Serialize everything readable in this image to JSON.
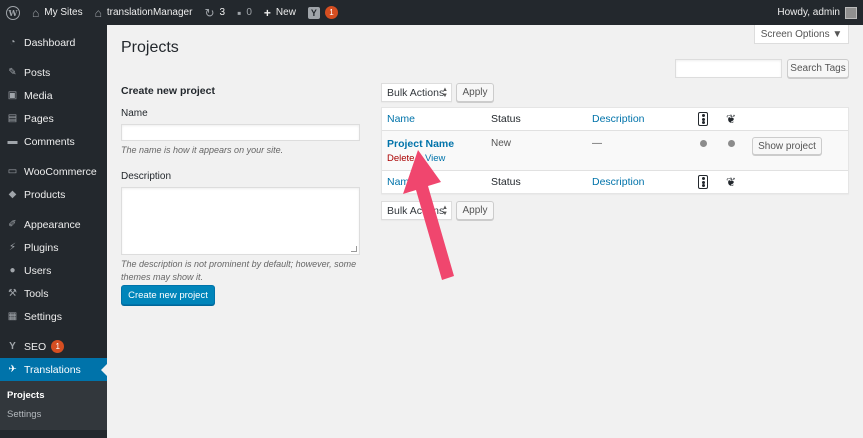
{
  "adminbar": {
    "my_sites": "My Sites",
    "site_name": "translationManager",
    "updates_count": "3",
    "comments_count": "0",
    "new_label": "New",
    "yoast_badge": "1",
    "howdy": "Howdy, admin"
  },
  "sidebar": {
    "items": [
      {
        "label": "Dashboard",
        "icon": "dashboard-icon"
      },
      {
        "label": "Posts",
        "icon": "pin-icon"
      },
      {
        "label": "Media",
        "icon": "media-icon"
      },
      {
        "label": "Pages",
        "icon": "pages-icon"
      },
      {
        "label": "Comments",
        "icon": "comments-icon"
      },
      {
        "label": "WooCommerce",
        "icon": "woocommerce-icon"
      },
      {
        "label": "Products",
        "icon": "products-icon"
      },
      {
        "label": "Appearance",
        "icon": "brush-icon"
      },
      {
        "label": "Plugins",
        "icon": "plugin-icon"
      },
      {
        "label": "Users",
        "icon": "users-icon"
      },
      {
        "label": "Tools",
        "icon": "wrench-icon"
      },
      {
        "label": "Settings",
        "icon": "settings-icon"
      },
      {
        "label": "SEO",
        "icon": "yoast-icon",
        "badge": "1"
      },
      {
        "label": "Translations",
        "icon": "translations-icon"
      }
    ],
    "submenu": [
      "Projects",
      "Settings"
    ]
  },
  "screen_options": "Screen Options ▼",
  "page_title": "Projects",
  "search_tags_button": "Search Tags",
  "form": {
    "heading": "Create new project",
    "name_label": "Name",
    "name_help": "The name is how it appears on your site.",
    "description_label": "Description",
    "description_help": "The description is not prominent by default; however, some themes may show it.",
    "submit": "Create new project"
  },
  "table": {
    "bulk_actions": "Bulk Actions",
    "apply": "Apply",
    "columns": {
      "name": "Name",
      "status": "Status",
      "description": "Description"
    },
    "rows": [
      {
        "name": "Project Name",
        "delete": "Delete",
        "view": "View",
        "status": "New",
        "description": "—",
        "action": "Show project"
      }
    ]
  },
  "colors": {
    "accent": "#0073aa",
    "adminbar": "#23282d",
    "annotation_arrow": "#f0466e"
  }
}
